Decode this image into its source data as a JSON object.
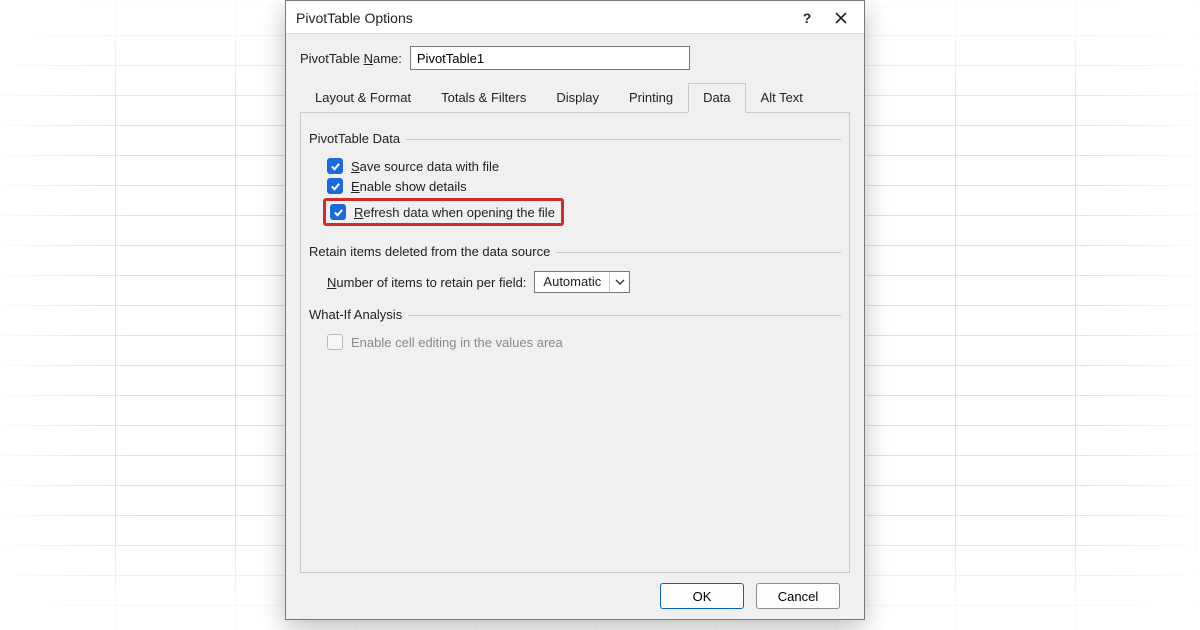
{
  "dialog": {
    "title": "PivotTable Options",
    "name_label": "PivotTable Name:",
    "name_value": "PivotTable1",
    "tabs": {
      "layout": "Layout & Format",
      "totals": "Totals & Filters",
      "display": "Display",
      "printing": "Printing",
      "data": "Data",
      "alttext": "Alt Text"
    },
    "active_tab": "Data",
    "sections": {
      "pivot_data": "PivotTable Data",
      "retain": "Retain items deleted from the data source",
      "whatif": "What-If Analysis"
    },
    "checkboxes": {
      "save_source": "Save source data with file",
      "show_details": "Enable show details",
      "refresh_open": "Refresh data when opening the file",
      "enable_cell_edit": "Enable cell editing in the values area"
    },
    "retain_label": "Number of items to retain per field:",
    "retain_value": "Automatic",
    "ok": "OK",
    "cancel": "Cancel"
  }
}
